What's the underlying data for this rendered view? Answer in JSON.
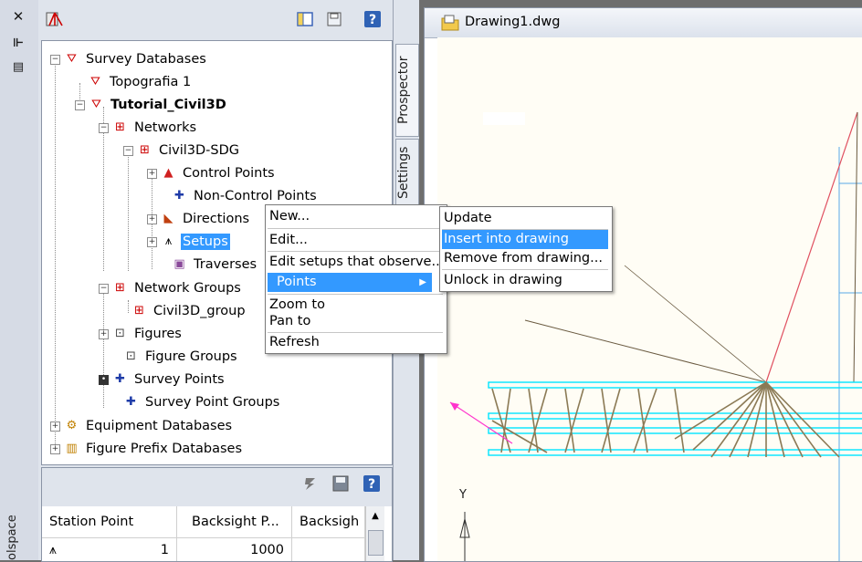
{
  "sidebar": {
    "close_glyph": "✕",
    "pin_glyph": "⊩",
    "props_glyph": "▤",
    "workspace_label": "olspace"
  },
  "tabs": {
    "prospector": "Prospector",
    "settings": "Settings"
  },
  "tree": {
    "survey_databases": "Survey Databases",
    "topografia": "Topografia 1",
    "tutorial": "Tutorial_Civil3D",
    "networks": "Networks",
    "civil3d_sdg": "Civil3D-SDG",
    "control_points": "Control Points",
    "non_control_points": "Non-Control Points",
    "directions": "Directions",
    "setups": "Setups",
    "traverses": "Traverses",
    "network_groups": "Network Groups",
    "civil3d_group": "Civil3D_group",
    "figures": "Figures",
    "figure_groups": "Figure Groups",
    "survey_points": "Survey Points",
    "survey_point_groups": "Survey Point Groups",
    "equipment_databases": "Equipment Databases",
    "figure_prefix_databases": "Figure Prefix Databases"
  },
  "grid": {
    "headers": [
      "Station Point",
      "Backsight P...",
      "Backsigh"
    ],
    "row": [
      "1",
      "1000",
      ""
    ]
  },
  "drawing": {
    "title": "Drawing1.dwg",
    "ucs_y": "Y"
  },
  "context_menu": {
    "new": "New...",
    "edit": "Edit...",
    "edit_setups": "Edit setups that observe...",
    "points": "Points",
    "zoom_to": "Zoom to",
    "pan_to": "Pan to",
    "refresh": "Refresh"
  },
  "points_submenu": {
    "update": "Update",
    "insert": "Insert into drawing",
    "remove": "Remove from drawing...",
    "unlock": "Unlock in drawing"
  },
  "colors": {
    "selection": "#3399ff",
    "panel": "#dfe4ec",
    "survey_lines": "#8b7a55",
    "cyan_lines": "#00e5ff"
  }
}
